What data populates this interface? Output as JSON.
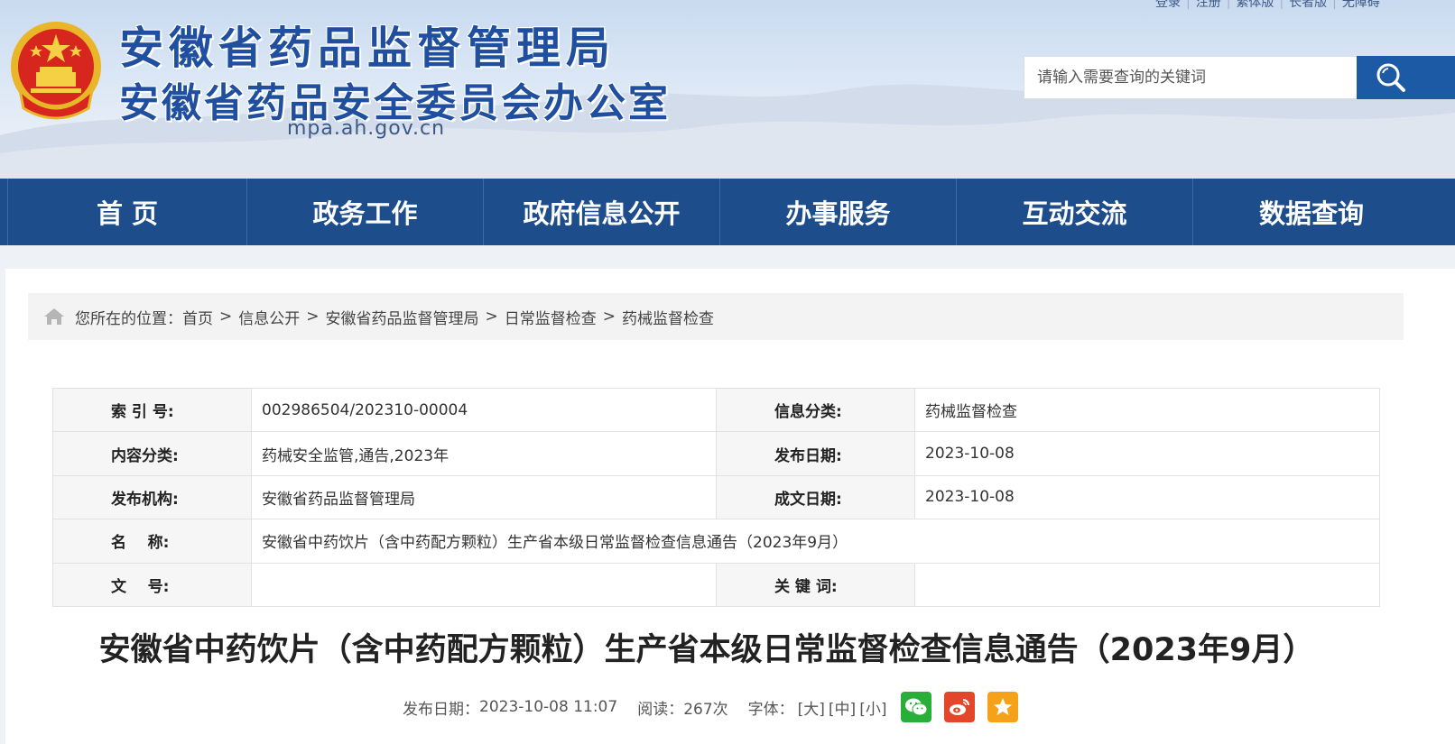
{
  "header": {
    "title_line1": "安徽省药品监督管理局",
    "title_line2": "安徽省药品安全委员会办公室",
    "domain": "mpa.ah.gov.cn",
    "toplinks": [
      "登录",
      "注册",
      "繁体版",
      "长者版",
      "无障碍"
    ],
    "search": {
      "placeholder": "请输入需要查询的关键词"
    },
    "colors": {
      "title": "#1f4f9e",
      "nav_bg": "#1e4d8c",
      "search_btn": "#1d5aa5"
    }
  },
  "nav": {
    "items": [
      "首 页",
      "政务工作",
      "政府信息公开",
      "办事服务",
      "互动交流",
      "数据查询"
    ]
  },
  "breadcrumb": {
    "prefix": "您所在的位置：",
    "items": [
      "首页",
      "信息公开",
      "安徽省药品监督管理局",
      "日常监督检查",
      "药械监督检查"
    ],
    "separator": ">"
  },
  "info": {
    "index_label": "索 引 号:",
    "index_value": "002986504/202310-00004",
    "category_label": "信息分类:",
    "category_value": "药械监督检查",
    "content_label": "内容分类:",
    "content_value": "药械安全监管,通告,2023年",
    "publish_label": "发布日期:",
    "publish_value": "2023-10-08",
    "org_label": "发布机构:",
    "org_value": "安徽省药品监督管理局",
    "written_label": "成文日期:",
    "written_value": "2023-10-08",
    "name_label": "名    称:",
    "name_value": "安徽省中药饮片（含中药配方颗粒）生产省本级日常监督检查信息通告（2023年9月）",
    "docno_label": "文    号:",
    "docno_value": "",
    "keywords_label": "关 键 词:",
    "keywords_value": ""
  },
  "article": {
    "title": "安徽省中药饮片（含中药配方颗粒）生产省本级日常监督检查信息通告（2023年9月）",
    "date_label": "发布日期：",
    "date_value": "2023-10-08 11:07",
    "views_label": "阅读：",
    "views_value": "267次",
    "font_label": "字体：",
    "font_large": "[大]",
    "font_medium": "[中]",
    "font_small": "[小]",
    "share_icons": [
      "wechat-icon",
      "weibo-icon",
      "qzone-icon"
    ]
  }
}
